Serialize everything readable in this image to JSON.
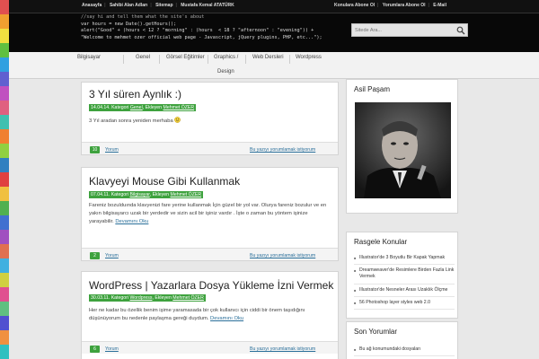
{
  "topbar": {
    "links": [
      "Anasayfa",
      "Sahibi Alan Adları",
      "Sitemap",
      "Mustafa Kemal ATATÜRK"
    ],
    "right_links": [
      "Konulara Abone Ol",
      "Yorumlara Abone Ol",
      "E-Mail"
    ]
  },
  "header": {
    "code_lines": [
      "//say hi and tell them what the site's about",
      "var hours = new Date().getHours();",
      "alert(\"Good\" + (hours < 12 ? \"morning\" : (hours  < 18 ? \"afternoon\" : \"evening\")) +",
      "\"Welcome to mehmet ozer official web page - Javascript, jQuery plugins, PHP, etc...\");"
    ],
    "search_placeholder": "Sitede Ara..."
  },
  "nav": {
    "items": [
      "Bilgisayar",
      "Genel",
      "Görsel Eğitimler",
      "Graphics /",
      "Web Dersleri",
      "Wordpress",
      "Design"
    ]
  },
  "posts": [
    {
      "title": "3 Yıl süren Aynlık :)",
      "date": "14.04.14.",
      "category_prefix": "Kategori",
      "category": "Genel",
      "author_prefix": "Ekleyen",
      "author": "Mehmet ÖZER",
      "excerpt": "3 Yıl aradan sonra yeniden merhaba",
      "read_more": "",
      "comments": "10",
      "forum_label": "Yorum",
      "comment_link": "Bu yazıyı yorumlamak istiyorum"
    },
    {
      "title": "Klavyeyi Mouse Gibi Kullanmak",
      "date": "07.04.11.",
      "category_prefix": "Kategori",
      "category": "Bilgisayar",
      "author_prefix": "Ekleyen",
      "author": "Mehmet ÖZER",
      "excerpt": "Fareniz  bozulduında klavyenizi fare yerine kullanmak İçin güzel bir yol var. Olurya fareniz bozulur ve en yakın bilgisayarcı uzak bir yerdedir ve sizin  acil bir işiniz vardır . İşte o zaman bu yöntem işinize yarayabilir.",
      "read_more": "Devamını Oku",
      "comments": "2",
      "forum_label": "Yorum",
      "comment_link": "Bu yazıyı yorumlamak istiyorum"
    },
    {
      "title": "WordPress | Yazarlara Dosya Yükleme İzni Vermek",
      "date": "30.03.11.",
      "category_prefix": "Kategori",
      "category": "Wordpress",
      "author_prefix": "Ekleyen",
      "author": "Mehmet ÖZER",
      "excerpt": "Her ne kadar bu özellik benim işime yaramasada  bir çok kullanıcı için ciddi bir önem taşıdığını düşünüyorum bu nedenle paylaşma gereği duydum.",
      "read_more": "Devamını Oku",
      "comments": "6",
      "forum_label": "Yorum",
      "comment_link": "Bu yazıyı yorumlamak istiyorum"
    }
  ],
  "sidebar": {
    "widget1_title": "Asil Paşam",
    "widget2_title": "Rasgele Konular",
    "random_topics": [
      "Illustrator'de 3 Boyutlu Bir Kapak Yapmak",
      "Dreamweaver'de Resimlere Birden Fazla Link Vermek",
      "Illustrator'de Nesneler Arası Uzaklık Ölçme",
      "56 Photoshop layer styles web 2.0"
    ],
    "widget3_title": "Son Yorumlar",
    "recent_comments": [
      "Bu ağ konumundaki dosyaları"
    ]
  },
  "colors": {
    "accent_green": "#3ea23e",
    "header_bg": "#080808",
    "link": "#2a6f9a"
  }
}
